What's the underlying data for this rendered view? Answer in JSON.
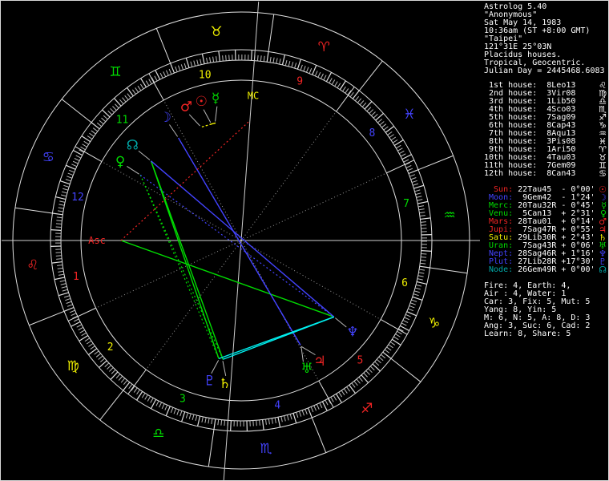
{
  "app": {
    "name": "Astrolog 5.40"
  },
  "panel": {
    "header_lines": [
      "Astrolog 5.40",
      "\"Anonymous\"",
      "Sat May 14, 1983",
      "10:36am (ST +8:00 GMT)",
      "\"Taipei\"",
      "121°31E 25°03N",
      "Placidus houses.",
      "Tropical, Geocentric.",
      "Julian Day = 2445468.6083"
    ],
    "houses": [
      {
        "label": " 1st house:",
        "value": "8Leo13",
        "element": "fire",
        "glyph": "♌"
      },
      {
        "label": " 2nd house:",
        "value": "3Vir08",
        "element": "earth",
        "glyph": "♍"
      },
      {
        "label": " 3rd house:",
        "value": "1Lib50",
        "element": "air",
        "glyph": "♎"
      },
      {
        "label": " 4th house:",
        "value": "4Sco03",
        "element": "water",
        "glyph": "♏"
      },
      {
        "label": " 5th house:",
        "value": "7Sag09",
        "element": "fire",
        "glyph": "♐"
      },
      {
        "label": " 6th house:",
        "value": "8Cap43",
        "element": "earth",
        "glyph": "♑"
      },
      {
        "label": " 7th house:",
        "value": "8Aqu13",
        "element": "air",
        "glyph": "♒"
      },
      {
        "label": " 8th house:",
        "value": "3Pis08",
        "element": "water",
        "glyph": "♓"
      },
      {
        "label": " 9th house:",
        "value": "1Ari50",
        "element": "fire",
        "glyph": "♈"
      },
      {
        "label": "10th house:",
        "value": "4Tau03",
        "element": "earth",
        "glyph": "♉"
      },
      {
        "label": "11th house:",
        "value": "7Gem09",
        "element": "air",
        "glyph": "♊"
      },
      {
        "label": "12th house:",
        "value": "8Can43",
        "element": "water",
        "glyph": "♋"
      }
    ],
    "planets": [
      {
        "label": "  Sun:",
        "lc": "red",
        "value": "22Tau45",
        "vc": "earth",
        "retro": " ",
        "delta": "- 0°00'",
        "glyph": "☉",
        "name": "Sun",
        "lon": 52.75,
        "shift": 1.5
      },
      {
        "label": " Moon:",
        "lc": "blue",
        "value": " 9Gem42",
        "vc": "air",
        "retro": " ",
        "delta": "- 1°24'",
        "glyph": "☽",
        "name": "Moon",
        "lon": 69.7,
        "shift": 0.3
      },
      {
        "label": " Merc:",
        "lc": "green",
        "value": "20Tau32",
        "vc": "earth",
        "retro": "R",
        "delta": "- 0°45'",
        "glyph": "☿",
        "name": "Mercury",
        "lon": 50.533,
        "shift": -2.1
      },
      {
        "label": " Venu:",
        "lc": "green",
        "value": " 5Can13",
        "vc": "water",
        "retro": " ",
        "delta": "+ 2°31'",
        "glyph": "♀",
        "name": "Venus",
        "lon": 95.217,
        "shift": 0
      },
      {
        "label": " Mars:",
        "lc": "red",
        "value": "28Tau01",
        "vc": "earth",
        "retro": " ",
        "delta": "+ 0°14'",
        "glyph": "♂",
        "name": "Mars",
        "lon": 58.017,
        "shift": 2.6
      },
      {
        "label": " Jupi:",
        "lc": "red",
        "value": " 7Sag47",
        "vc": "fire",
        "retro": "R",
        "delta": "+ 0°55'",
        "glyph": "♃",
        "name": "Jupiter",
        "lon": 247.783,
        "shift": 3.4
      },
      {
        "label": " Satu:",
        "lc": "yellow",
        "value": "29Lib30",
        "vc": "air",
        "retro": "R",
        "delta": "+ 2°43'",
        "glyph": "♄",
        "name": "Saturn",
        "lon": 209.5,
        "shift": 2.2
      },
      {
        "label": " Uran:",
        "lc": "green",
        "value": " 7Sag43",
        "vc": "fire",
        "retro": "R",
        "delta": "+ 0°06'",
        "glyph": "♅",
        "name": "Uranus",
        "lon": 247.717,
        "shift": -2.4
      },
      {
        "label": " Nept:",
        "lc": "blue",
        "value": "28Sag46",
        "vc": "fire",
        "retro": "R",
        "delta": "+ 1°16'",
        "glyph": "♆",
        "name": "Neptune",
        "lon": 268.767,
        "shift": 0
      },
      {
        "label": " Plut:",
        "lc": "blue",
        "value": "27Lib28",
        "vc": "air",
        "retro": "R",
        "delta": "+17°30'",
        "glyph": "♇",
        "name": "Pluto",
        "lon": 207.467,
        "shift": -1.9
      },
      {
        "label": " Node:",
        "lc": "teal",
        "value": "26Gem49",
        "vc": "air",
        "retro": "R",
        "delta": "+ 0°00'",
        "glyph": "☊",
        "name": "Node",
        "lon": 86.817,
        "shift": 0.3
      }
    ],
    "stats_lines": [
      "Fire: 4, Earth: 4,",
      "Air : 4, Water: 1",
      "Car: 3, Fix: 5, Mut: 5",
      "Yang: 8, Yin: 5",
      "M: 6, N: 5, A: 8, D: 3",
      "Ang: 3, Suc: 6, Cad: 2",
      "Learn: 8, Share: 5"
    ]
  },
  "wheel": {
    "asc_lon": 128.217,
    "signs": [
      {
        "name": "Aries",
        "glyph": "♈",
        "element": "fire"
      },
      {
        "name": "Taurus",
        "glyph": "♉",
        "element": "earth"
      },
      {
        "name": "Gemini",
        "glyph": "♊",
        "element": "air"
      },
      {
        "name": "Cancer",
        "glyph": "♋",
        "element": "water"
      },
      {
        "name": "Leo",
        "glyph": "♌",
        "element": "fire"
      },
      {
        "name": "Virgo",
        "glyph": "♍",
        "element": "earth"
      },
      {
        "name": "Libra",
        "glyph": "♎",
        "element": "air"
      },
      {
        "name": "Scorpio",
        "glyph": "♏",
        "element": "water"
      },
      {
        "name": "Sagittarius",
        "glyph": "♐",
        "element": "fire"
      },
      {
        "name": "Capricorn",
        "glyph": "♑",
        "element": "earth"
      },
      {
        "name": "Aquarius",
        "glyph": "♒",
        "element": "air"
      },
      {
        "name": "Pisces",
        "glyph": "♓",
        "element": "water"
      }
    ],
    "houses_lon": [
      128.217,
      153.133,
      181.833,
      214.05,
      247.15,
      278.717,
      308.217,
      333.133,
      1.833,
      34.05,
      67.15,
      98.717
    ],
    "points": {
      "Asc": 128.217,
      "MC": 34.05
    },
    "labels": [
      {
        "text": "Asc",
        "lon": 128.217,
        "r": 180,
        "dphi": 0,
        "color": "red"
      },
      {
        "text": "MC",
        "lon": 34.05,
        "r": 181,
        "dphi": -0.6,
        "color": "yellow"
      }
    ],
    "aspects": [
      {
        "a": "Node",
        "b": "Saturn",
        "color": "green",
        "style": "solid"
      },
      {
        "a": "Node",
        "b": "Pluto",
        "color": "green",
        "style": "solid"
      },
      {
        "a": "Asc",
        "b": "Neptune",
        "color": "green",
        "style": "solid"
      },
      {
        "a": "Venus",
        "b": "Saturn",
        "color": "green",
        "style": "dotted"
      },
      {
        "a": "Venus",
        "b": "Pluto",
        "color": "green",
        "style": "dotted"
      },
      {
        "a": "Moon",
        "b": "Jupiter",
        "color": "blue",
        "style": "solid"
      },
      {
        "a": "Node",
        "b": "Neptune",
        "color": "blue",
        "style": "solid"
      },
      {
        "a": "Moon",
        "b": "Uranus",
        "color": "blue",
        "style": "dotted"
      },
      {
        "a": "Venus",
        "b": "Neptune",
        "color": "blue",
        "style": "dotted"
      },
      {
        "a": "Saturn",
        "b": "Neptune",
        "color": "cyan",
        "style": "solid"
      },
      {
        "a": "Pluto",
        "b": "Neptune",
        "color": "cyan",
        "style": "solid"
      },
      {
        "a": "Asc",
        "b": "MC",
        "color": "red",
        "style": "dotted"
      },
      {
        "a": "Sun",
        "b": "Mercury",
        "color": "yellow",
        "style": "solid"
      },
      {
        "a": "Sun",
        "b": "Mars",
        "color": "yellow",
        "style": "dotted"
      },
      {
        "a": "Mercury",
        "b": "Mars",
        "color": "yellow",
        "style": "dotted"
      }
    ]
  },
  "colors": {
    "red": "#f22424",
    "yellow": "#efef00",
    "green": "#00dd00",
    "blue": "#4343ff",
    "teal": "#00a8a8",
    "cyan": "#00eeee",
    "white": "#ffffff",
    "gray": "#b8b8b8",
    "dimgray": "#989898",
    "circle": "#e0e0e0",
    "fire": "#f22424",
    "earth": "#efef00",
    "air": "#00dd00",
    "water": "#4343ff"
  }
}
